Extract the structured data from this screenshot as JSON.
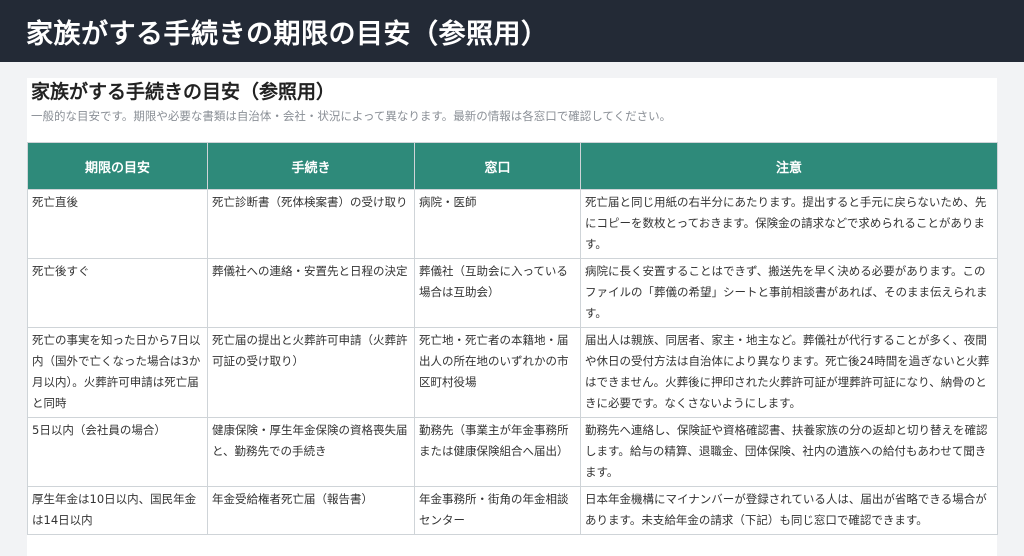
{
  "header": {
    "title": "家族がする手続きの期限の目安（参照用）"
  },
  "card": {
    "title": "家族がする手続きの目安（参照用）",
    "subtitle": "一般的な目安です。期限や必要な書類は自治体・会社・状況によって異なります。最新の情報は各窓口で確認してください。"
  },
  "table": {
    "columns": [
      "期限の目安",
      "手続き",
      "窓口",
      "注意"
    ],
    "rows": [
      {
        "deadline": "死亡直後",
        "procedure": "死亡診断書（死体検案書）の受け取り",
        "office": "病院・医師",
        "note": "死亡届と同じ用紙の右半分にあたります。提出すると手元に戻らないため、先にコピーを数枚とっておきます。保険金の請求などで求められることがあります。"
      },
      {
        "deadline": "死亡後すぐ",
        "procedure": "葬儀社への連絡・安置先と日程の決定",
        "office": "葬儀社（互助会に入っている場合は互助会）",
        "note": "病院に長く安置することはできず、搬送先を早く決める必要があります。このファイルの「葬儀の希望」シートと事前相談書があれば、そのまま伝えられます。"
      },
      {
        "deadline": "死亡の事実を知った日から7日以内（国外で亡くなった場合は3か月以内）。火葬許可申請は死亡届と同時",
        "procedure": "死亡届の提出と火葬許可申請（火葬許可証の受け取り）",
        "office": "死亡地・死亡者の本籍地・届出人の所在地のいずれかの市区町村役場",
        "note": "届出人は親族、同居者、家主・地主など。葬儀社が代行することが多く、夜間や休日の受付方法は自治体により異なります。死亡後24時間を過ぎないと火葬はできません。火葬後に押印された火葬許可証が埋葬許可証になり、納骨のときに必要です。なくさないようにします。"
      },
      {
        "deadline": "5日以内（会社員の場合）",
        "procedure": "健康保険・厚生年金保険の資格喪失届と、勤務先での手続き",
        "office": "勤務先（事業主が年金事務所または健康保険組合へ届出）",
        "note": "勤務先へ連絡し、保険証や資格確認書、扶養家族の分の返却と切り替えを確認します。給与の精算、退職金、団体保険、社内の遺族への給付もあわせて聞きます。"
      },
      {
        "deadline": "厚生年金は10日以内、国民年金は14日以内",
        "procedure": "年金受給権者死亡届（報告書）",
        "office": "年金事務所・街角の年金相談センター",
        "note": "日本年金機構にマイナンバーが登録されている人は、届出が省略できる場合があります。未支給年金の請求（下記）も同じ窓口で確認できます。"
      }
    ]
  }
}
